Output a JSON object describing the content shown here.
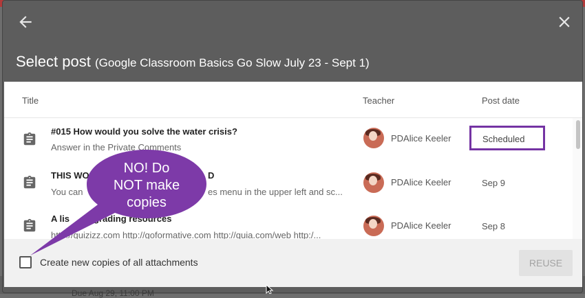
{
  "background": {
    "text": "Due Aug 29, 11:00 PM"
  },
  "dialog": {
    "title": "Select post",
    "course": "(Google Classroom Basics Go Slow July 23 - Sept 1)",
    "columns": {
      "title": "Title",
      "teacher": "Teacher",
      "post_date": "Post date"
    },
    "rows": [
      {
        "title": "#015 How would you solve the water crisis?",
        "snippet": "Answer in the Private Comments",
        "teacher": "PDAlice Keeler",
        "post_date": "Scheduled",
        "icon": "assignment-icon"
      },
      {
        "title": "THIS WO",
        "title_tail": "D",
        "snippet": "You can",
        "snippet_tail": "es menu in the upper left and sc...",
        "teacher": "PDAlice Keeler",
        "post_date": "Sep 9",
        "icon": "assignment-icon"
      },
      {
        "title": "A lis",
        "title_tail": "grading resources",
        "snippet": "http://quizizz.com http://goformative.com http://quia.com/web http:/...",
        "teacher": "PDAlice Keeler",
        "post_date": "Sep 8",
        "icon": "assignment-icon"
      }
    ],
    "footer": {
      "checkbox_label": "Create new copies of all attachments",
      "reuse_button": "REUSE"
    }
  },
  "annotation": {
    "line1": "NO! Do",
    "line2": "NOT make",
    "line3": "copies",
    "color": "#7d3aa8"
  },
  "colors": {
    "header": "#5d5d5d",
    "highlight_border": "#7433a3"
  }
}
